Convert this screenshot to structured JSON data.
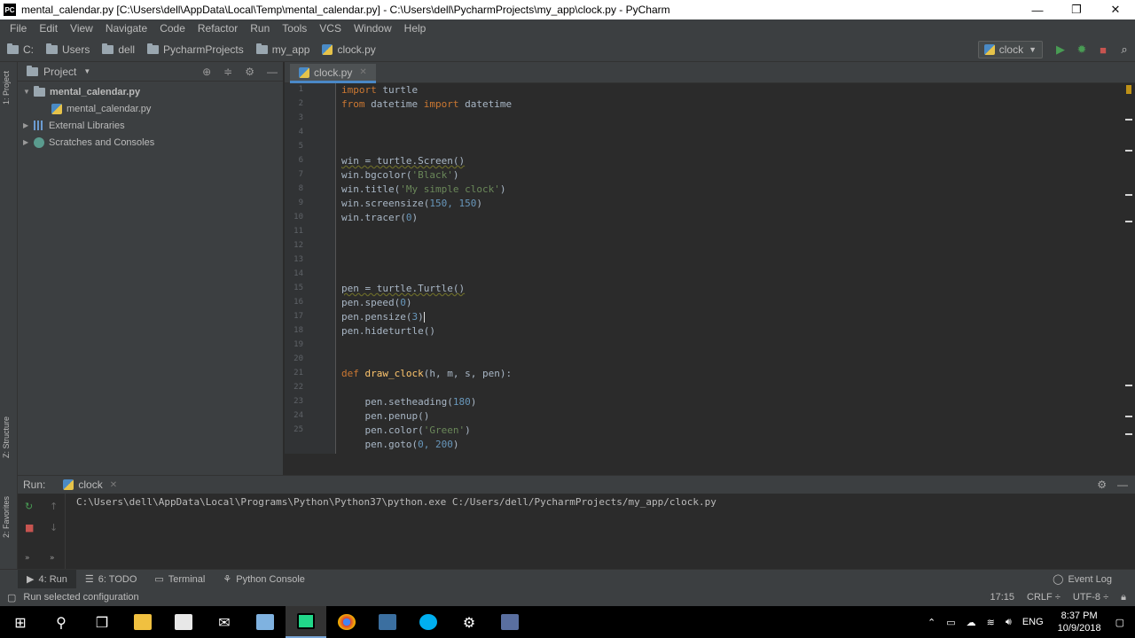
{
  "window": {
    "title": "mental_calendar.py [C:\\Users\\dell\\AppData\\Local\\Temp\\mental_calendar.py] - C:\\Users\\dell\\PycharmProjects\\my_app\\clock.py - PyCharm",
    "app_badge": "PC",
    "minimize": "—",
    "restore": "❐",
    "close": "✕"
  },
  "menu": [
    "File",
    "Edit",
    "View",
    "Navigate",
    "Code",
    "Refactor",
    "Run",
    "Tools",
    "VCS",
    "Window",
    "Help"
  ],
  "breadcrumbs": [
    "C:",
    "Users",
    "dell",
    "PycharmProjects",
    "my_app",
    "clock.py"
  ],
  "run_config": "clock",
  "left_stripe": {
    "project": "1: Project",
    "structure": "Z: Structure",
    "favorites": "2: Favorites"
  },
  "project_panel": {
    "title": "Project",
    "tree": [
      {
        "label": "mental_calendar.py",
        "level": 0,
        "expanded": true
      },
      {
        "label": "mental_calendar.py",
        "level": 1
      },
      {
        "label": "External Libraries",
        "level": 0
      },
      {
        "label": "Scratches and Consoles",
        "level": 0
      }
    ]
  },
  "editor": {
    "tab": "clock.py",
    "line_numbers": [
      "1",
      "2",
      "3",
      "4",
      "5",
      "6",
      "7",
      "8",
      "9",
      "10",
      "11",
      "12",
      "13",
      "14",
      "15",
      "16",
      "17",
      "18",
      "19",
      "20",
      "21",
      "22",
      "23",
      "24",
      "25"
    ],
    "code": {
      "l1_kw": "import",
      "l1_rest": " turtle",
      "l2_kw1": "from",
      "l2_mid": " datetime ",
      "l2_kw2": "import",
      "l2_rest": " datetime",
      "l5": "win = turtle.Screen()",
      "l6_a": "win.bgcolor(",
      "l6_s": "'Black'",
      "l6_b": ")",
      "l7_a": "win.title(",
      "l7_s": "'My simple clock'",
      "l7_b": ")",
      "l8_a": "win.screensize(",
      "l8_n": "150, 150",
      "l8_b": ")",
      "l9_a": "win.tracer(",
      "l9_n": "0",
      "l9_b": ")",
      "l13": "pen = turtle.Turtle()",
      "l14_a": "pen.speed(",
      "l14_n": "0",
      "l14_b": ")",
      "l15_a": "pen.pensize(",
      "l15_n": "3",
      "l15_b": ")",
      "l16": "pen.hideturtle()",
      "l18_kw": "def",
      "l18_fn": " draw_clock",
      "l18_rest": "(h, m, s, pen):",
      "l20_a": "    pen.setheading(",
      "l20_n": "180",
      "l20_b": ")",
      "l21": "    pen.penup()",
      "l22_a": "    pen.color(",
      "l22_s": "'Green'",
      "l22_b": ")",
      "l23_a": "    pen.goto(",
      "l23_n": "0, 200",
      "l23_b": ")"
    }
  },
  "run_panel": {
    "label": "Run:",
    "tab": "clock",
    "console": "C:\\Users\\dell\\AppData\\Local\\Programs\\Python\\Python37\\python.exe C:/Users/dell/PycharmProjects/my_app/clock.py"
  },
  "tool_windows": [
    "4: Run",
    "6: TODO",
    "Terminal",
    "Python Console"
  ],
  "event_log": "Event Log",
  "status": {
    "message": "Run selected configuration",
    "position": "17:15",
    "line_sep": "CRLF ÷",
    "encoding": "UTF-8 ÷"
  },
  "taskbar": {
    "lang": "ENG",
    "time": "8:37 PM",
    "date": "10/9/2018"
  },
  "colors": {
    "keyword": "#cc7832",
    "string": "#6a8759",
    "number": "#6897bb",
    "function": "#ffc66d",
    "run_green": "#499c54",
    "stop_red": "#c75450"
  }
}
